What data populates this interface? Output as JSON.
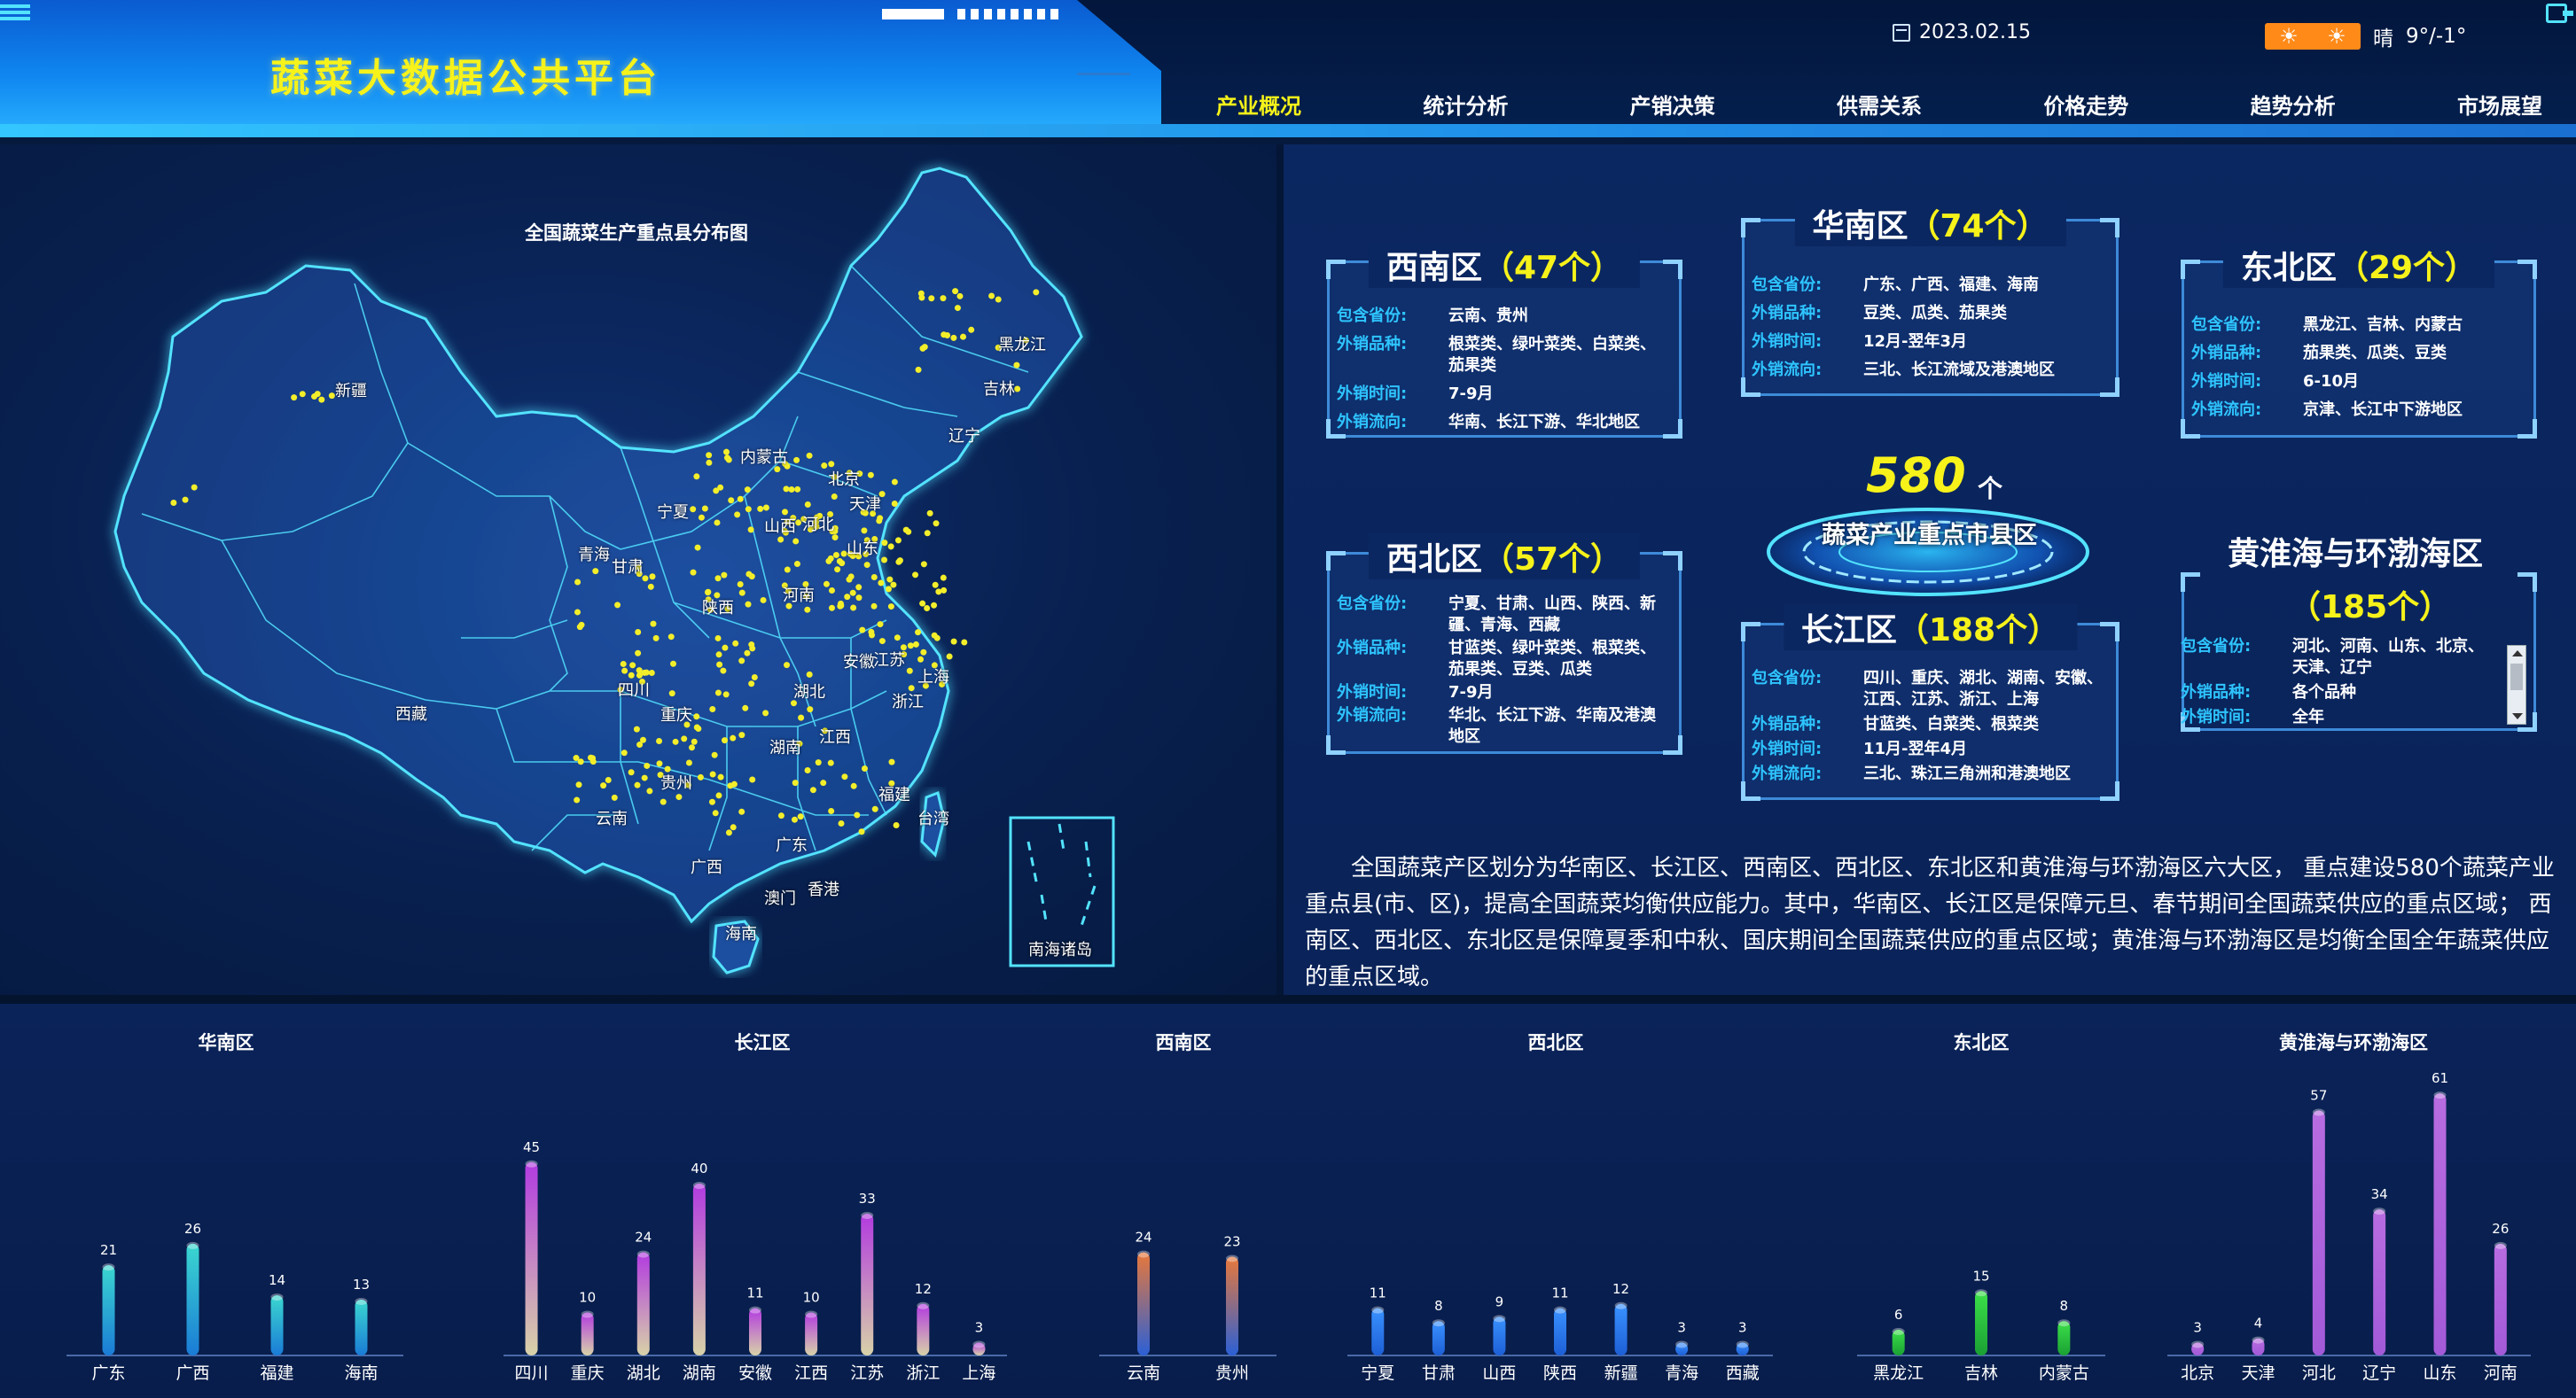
{
  "header": {
    "title": "蔬菜大数据公共平台",
    "date": "2023.02.15",
    "weather_text": "晴",
    "temperature": "9°/-1°",
    "weather_icons": [
      "sun-icon",
      "sun-icon"
    ]
  },
  "nav": [
    {
      "label": "产业概况",
      "active": true
    },
    {
      "label": "统计分析",
      "active": false
    },
    {
      "label": "产销决策",
      "active": false
    },
    {
      "label": "供需关系",
      "active": false
    },
    {
      "label": "价格走势",
      "active": false
    },
    {
      "label": "趋势分析",
      "active": false
    },
    {
      "label": "市场展望",
      "active": false
    }
  ],
  "map": {
    "title": "全国蔬菜生产重点县分布图",
    "inset_label": "南海诸岛",
    "provinces": [
      "新疆",
      "西藏",
      "青海",
      "甘肃",
      "内蒙古",
      "宁夏",
      "陕西",
      "山西",
      "河北",
      "北京",
      "天津",
      "辽宁",
      "吉林",
      "黑龙江",
      "山东",
      "河南",
      "四川",
      "重庆",
      "湖北",
      "安徽",
      "江苏",
      "上海",
      "浙江",
      "湖南",
      "江西",
      "贵州",
      "云南",
      "广西",
      "广东",
      "福建",
      "台湾",
      "香港",
      "澳门",
      "海南"
    ]
  },
  "regions": {
    "southwest": {
      "name": "西南区",
      "count": "（47个）",
      "rows": [
        {
          "k": "包含省份:",
          "v": "云南、贵州"
        },
        {
          "k": "外销品种:",
          "v": "根菜类、绿叶菜类、白菜类、茄果类"
        },
        {
          "k": "外销时间:",
          "v": "7-9月"
        },
        {
          "k": "外销流向:",
          "v": "华南、长江下游、华北地区"
        }
      ]
    },
    "south": {
      "name": "华南区",
      "count": "（74个）",
      "rows": [
        {
          "k": "包含省份:",
          "v": "广东、广西、福建、海南"
        },
        {
          "k": "外销品种:",
          "v": "豆类、瓜类、茄果类"
        },
        {
          "k": "外销时间:",
          "v": "12月-翌年3月"
        },
        {
          "k": "外销流向:",
          "v": "三北、长江流域及港澳地区"
        }
      ]
    },
    "northeast": {
      "name": "东北区",
      "count": "（29个）",
      "rows": [
        {
          "k": "包含省份:",
          "v": "黑龙江、吉林、内蒙古"
        },
        {
          "k": "外销品种:",
          "v": "茄果类、瓜类、豆类"
        },
        {
          "k": "外销时间:",
          "v": "6-10月"
        },
        {
          "k": "外销流向:",
          "v": "京津、长江中下游地区"
        }
      ]
    },
    "northwest": {
      "name": "西北区",
      "count": "（57个）",
      "rows": [
        {
          "k": "包含省份:",
          "v": "宁夏、甘肃、山西、陕西、新疆、青海、西藏"
        },
        {
          "k": "外销品种:",
          "v": "甘蓝类、绿叶菜类、根菜类、茄果类、豆类、瓜类"
        },
        {
          "k": "外销时间:",
          "v": "7-9月"
        },
        {
          "k": "外销流向:",
          "v": "华北、长江下游、华南及港澳地区"
        }
      ]
    },
    "yangtze": {
      "name": "长江区",
      "count": "（188个）",
      "rows": [
        {
          "k": "包含省份:",
          "v": "四川、重庆、湖北、湖南、安徽、江西、江苏、浙江、上海"
        },
        {
          "k": "外销品种:",
          "v": "甘蓝类、白菜类、根菜类"
        },
        {
          "k": "外销时间:",
          "v": "11月-翌年4月"
        },
        {
          "k": "外销流向:",
          "v": "三北、珠江三角洲和港澳地区"
        }
      ]
    },
    "huanghuai": {
      "name": "黄淮海与环渤海区",
      "count": "（185个）",
      "rows": [
        {
          "k": "包含省份:",
          "v": "河北、河南、山东、北京、天津、辽宁"
        },
        {
          "k": "外销品种:",
          "v": "各个品种"
        },
        {
          "k": "外销时间:",
          "v": "全年"
        }
      ]
    }
  },
  "center": {
    "number": "580",
    "unit": "个",
    "label": "蔬菜产业重点市县区"
  },
  "description": "全国蔬菜产区划分为华南区、长江区、西南区、西北区、东北区和黄淮海与环渤海区六大区， 重点建设580个蔬菜产业重点县(市、区)，提高全国蔬菜均衡供应能力。其中，华南区、长江区是保障元旦、春节期间全国蔬菜供应的重点区域； 西南区、西北区、东北区是保障夏季和中秋、国庆期间全国蔬菜供应的重点区域；黄淮海与环渤海区是均衡全国全年蔬菜供应的重点区域。",
  "colors": {
    "accent": "#f6f21a",
    "label_blue": "#2ec5ff",
    "card_border": "#3d8ad8"
  },
  "chart_data": [
    {
      "type": "bar",
      "title": "华南区",
      "categories": [
        "广东",
        "广西",
        "福建",
        "海南"
      ],
      "values": [
        21,
        26,
        14,
        13
      ]
    },
    {
      "type": "bar",
      "title": "长江区",
      "categories": [
        "四川",
        "重庆",
        "湖北",
        "湖南",
        "安徽",
        "江西",
        "江苏",
        "浙江",
        "上海"
      ],
      "values": [
        45,
        10,
        24,
        40,
        11,
        10,
        33,
        12,
        3
      ]
    },
    {
      "type": "bar",
      "title": "西南区",
      "categories": [
        "云南",
        "贵州"
      ],
      "values": [
        24,
        23
      ]
    },
    {
      "type": "bar",
      "title": "西北区",
      "categories": [
        "宁夏",
        "甘肃",
        "山西",
        "陕西",
        "新疆",
        "青海",
        "西藏"
      ],
      "values": [
        11,
        8,
        9,
        11,
        12,
        3,
        3
      ]
    },
    {
      "type": "bar",
      "title": "东北区",
      "categories": [
        "黑龙江",
        "吉林",
        "内蒙古"
      ],
      "values": [
        6,
        15,
        8
      ]
    },
    {
      "type": "bar",
      "title": "黄淮海与环渤海区",
      "categories": [
        "北京",
        "天津",
        "河北",
        "辽宁",
        "山东",
        "河南"
      ],
      "values": [
        3,
        4,
        57,
        34,
        61,
        26
      ]
    }
  ]
}
